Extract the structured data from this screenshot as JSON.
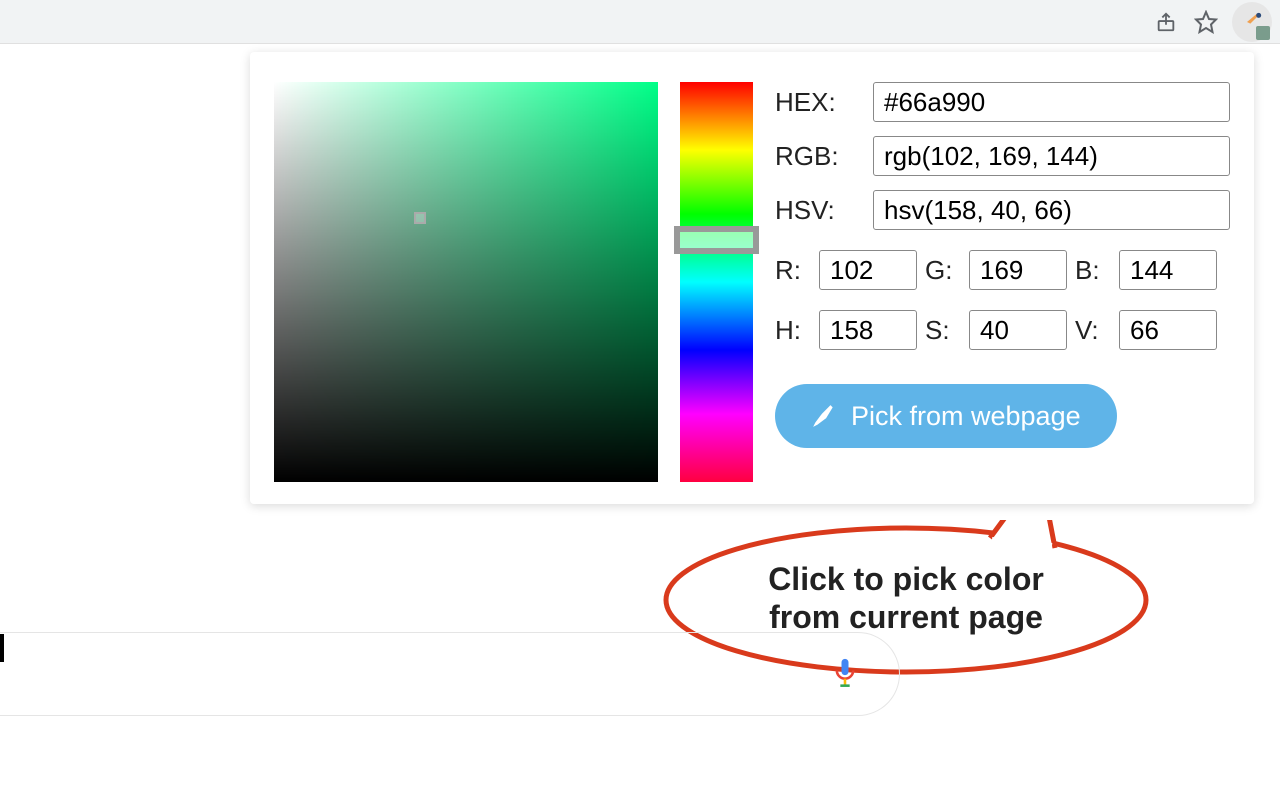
{
  "labels": {
    "hex": "HEX:",
    "rgb": "RGB:",
    "hsv": "HSV:",
    "r": "R:",
    "g": "G:",
    "b": "B:",
    "h": "H:",
    "s": "S:",
    "v": "V:"
  },
  "values": {
    "hex": "#66a990",
    "rgb": "rgb(102, 169, 144)",
    "hsv": "hsv(158, 40, 66)",
    "r": "102",
    "g": "169",
    "b": "144",
    "h": "158",
    "s": "40",
    "v": "66"
  },
  "button": {
    "pick": "Pick from webpage"
  },
  "callout": {
    "line1": "Click to pick color",
    "line2": "from current page"
  },
  "colors": {
    "selected": "#66a990",
    "button_bg": "#5fb4e8",
    "callout_stroke": "#d93a1c"
  }
}
